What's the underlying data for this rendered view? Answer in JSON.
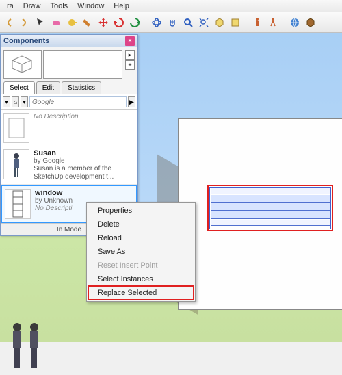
{
  "menu": [
    "ra",
    "Draw",
    "Tools",
    "Window",
    "Help"
  ],
  "panel": {
    "title": "Components",
    "tabs": [
      "Select",
      "Edit",
      "Statistics"
    ],
    "activeTab": 0,
    "searchPlaceholder": "Google",
    "items": [
      {
        "name": "",
        "author": "",
        "desc": "No Description",
        "thumb": "nodesc"
      },
      {
        "name": "Susan",
        "author": "by Google",
        "desc": "Susan is a member of the SketchUp development t...",
        "thumb": "person"
      },
      {
        "name": "window",
        "author": "by Unknown",
        "desc": "No Descripti",
        "thumb": "window",
        "selected": true
      }
    ],
    "footer": "In Mode"
  },
  "contextMenu": {
    "items": [
      {
        "label": "Properties",
        "disabled": false
      },
      {
        "label": "Delete",
        "disabled": false
      },
      {
        "label": "Reload",
        "disabled": false
      },
      {
        "label": "Save As",
        "disabled": false
      },
      {
        "label": "Reset Insert Point",
        "disabled": true
      },
      {
        "label": "Select Instances",
        "disabled": false
      },
      {
        "label": "Replace Selected",
        "disabled": false,
        "highlighted": true
      }
    ]
  },
  "icons": {
    "nav_back": "#d49a3a",
    "nav_fwd": "#d49a3a",
    "select": "#222",
    "eraser": "#d85a9a",
    "tape": "#d4a030",
    "paint": "#c07020",
    "move": "#d03030",
    "rotate": "#d03030",
    "scale": "#208030",
    "orbit": "#3060c0",
    "pan": "#3060c0",
    "zoom": "#3060c0",
    "zoomext": "#3060c0",
    "iso": "#c09020",
    "section": "#c09020",
    "person": "#c07030",
    "layers": "#c07030",
    "warehouse": "#3060c0",
    "component": "#805020"
  }
}
